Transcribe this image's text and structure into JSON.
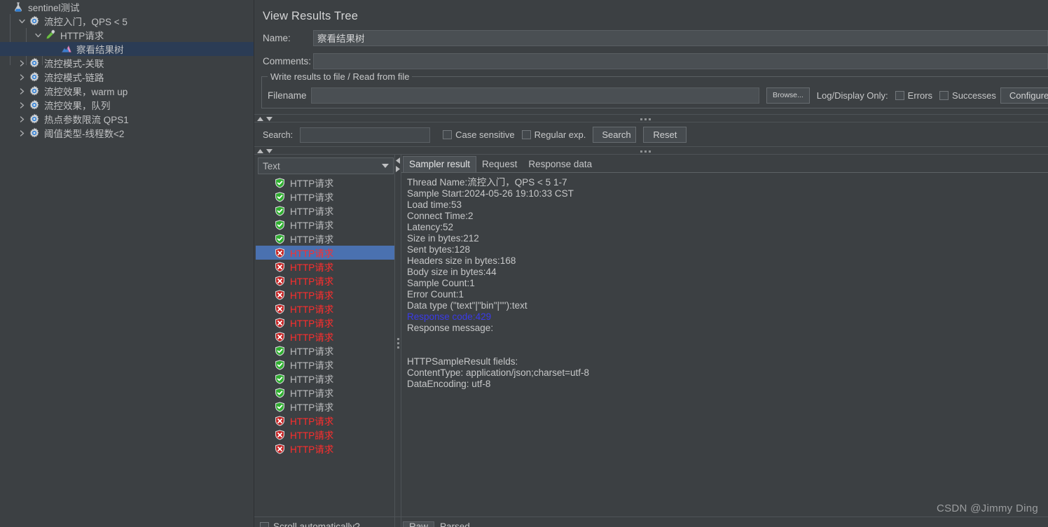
{
  "tree": {
    "nodes": [
      {
        "label": "sentinel测试",
        "icon": "flask-icon",
        "depth": 0,
        "twisty": "none",
        "selected": false
      },
      {
        "label": "流控入门，QPS < 5",
        "icon": "gear-icon",
        "depth": 1,
        "twisty": "expanded",
        "selected": false
      },
      {
        "label": "HTTP请求",
        "icon": "pipette-icon",
        "depth": 2,
        "twisty": "expanded",
        "selected": false
      },
      {
        "label": "察看结果树",
        "icon": "chart-icon",
        "depth": 3,
        "twisty": "none",
        "selected": true
      },
      {
        "label": "流控模式-关联",
        "icon": "gear-icon",
        "depth": 1,
        "twisty": "collapsed",
        "selected": false
      },
      {
        "label": "流控模式-链路",
        "icon": "gear-icon",
        "depth": 1,
        "twisty": "collapsed",
        "selected": false
      },
      {
        "label": "流控效果，warm up",
        "icon": "gear-icon",
        "depth": 1,
        "twisty": "collapsed",
        "selected": false
      },
      {
        "label": "流控效果，队列",
        "icon": "gear-icon",
        "depth": 1,
        "twisty": "collapsed",
        "selected": false
      },
      {
        "label": "热点参数限流 QPS1",
        "icon": "gear-icon",
        "depth": 1,
        "twisty": "collapsed",
        "selected": false
      },
      {
        "label": "阈值类型-线程数<2",
        "icon": "gear-icon",
        "depth": 1,
        "twisty": "collapsed",
        "selected": false
      }
    ]
  },
  "panel": {
    "title": "View Results Tree",
    "name_label": "Name:",
    "name_value": "察看结果树",
    "comments_label": "Comments:",
    "comments_value": "",
    "comments_placeholder": "",
    "group_title": "Write results to file / Read from file",
    "filename_label": "Filename",
    "filename_value": "",
    "browse_label": "Browse...",
    "log_display_label": "Log/Display Only:",
    "errors_label": "Errors",
    "successes_label": "Successes",
    "configure_label": "Configure"
  },
  "search": {
    "label": "Search:",
    "value": "",
    "case_sensitive_label": "Case sensitive",
    "regular_exp_label": "Regular exp.",
    "search_button": "Search",
    "reset_button": "Reset"
  },
  "results": {
    "render_selector_value": "Text",
    "scroll_auto_label": "Scroll automatically?",
    "items": [
      {
        "label": "HTTP请求",
        "status": "ok",
        "selected": false
      },
      {
        "label": "HTTP请求",
        "status": "ok",
        "selected": false
      },
      {
        "label": "HTTP请求",
        "status": "ok",
        "selected": false
      },
      {
        "label": "HTTP请求",
        "status": "ok",
        "selected": false
      },
      {
        "label": "HTTP请求",
        "status": "ok",
        "selected": false
      },
      {
        "label": "HTTP请求",
        "status": "err",
        "selected": true
      },
      {
        "label": "HTTP请求",
        "status": "err",
        "selected": false
      },
      {
        "label": "HTTP请求",
        "status": "err",
        "selected": false
      },
      {
        "label": "HTTP请求",
        "status": "err",
        "selected": false
      },
      {
        "label": "HTTP请求",
        "status": "err",
        "selected": false
      },
      {
        "label": "HTTP请求",
        "status": "err",
        "selected": false
      },
      {
        "label": "HTTP请求",
        "status": "err",
        "selected": false
      },
      {
        "label": "HTTP请求",
        "status": "ok",
        "selected": false
      },
      {
        "label": "HTTP请求",
        "status": "ok",
        "selected": false
      },
      {
        "label": "HTTP请求",
        "status": "ok",
        "selected": false
      },
      {
        "label": "HTTP请求",
        "status": "ok",
        "selected": false
      },
      {
        "label": "HTTP请求",
        "status": "ok",
        "selected": false
      },
      {
        "label": "HTTP请求",
        "status": "err",
        "selected": false
      },
      {
        "label": "HTTP請求",
        "status": "err",
        "selected": false
      },
      {
        "label": "HTTP请求",
        "status": "err",
        "selected": false
      }
    ]
  },
  "detail": {
    "tabs": [
      {
        "label": "Sampler result",
        "active": true
      },
      {
        "label": "Request",
        "active": false
      },
      {
        "label": "Response data",
        "active": false
      }
    ],
    "lines_before": "Thread Name:流控入门，QPS < 5 1-7\nSample Start:2024-05-26 19:10:33 CST\nLoad time:53\nConnect Time:2\nLatency:52\nSize in bytes:212\nSent bytes:128\nHeaders size in bytes:168\nBody size in bytes:44\nSample Count:1\nError Count:1\nData type (\"text\"|\"bin\"|\"\"):text",
    "response_code_line": "Response code:429",
    "lines_after": "Response message:\n\n\nHTTPSampleResult fields:\nContentType: application/json;charset=utf-8\nDataEncoding: utf-8",
    "bottom_tabs": [
      {
        "label": "Raw",
        "active": true
      },
      {
        "label": "Parsed",
        "active": false
      }
    ]
  },
  "watermark": {
    "text": "CSDN @Jimmy Ding"
  },
  "colors": {
    "background": "#3c4043",
    "selection_blue": "#4a71b0",
    "tree_selection": "#2b3c55",
    "error_red": "#ff2d2d",
    "link_blue": "#3a3ae8",
    "success_green": "#2faf2f"
  }
}
